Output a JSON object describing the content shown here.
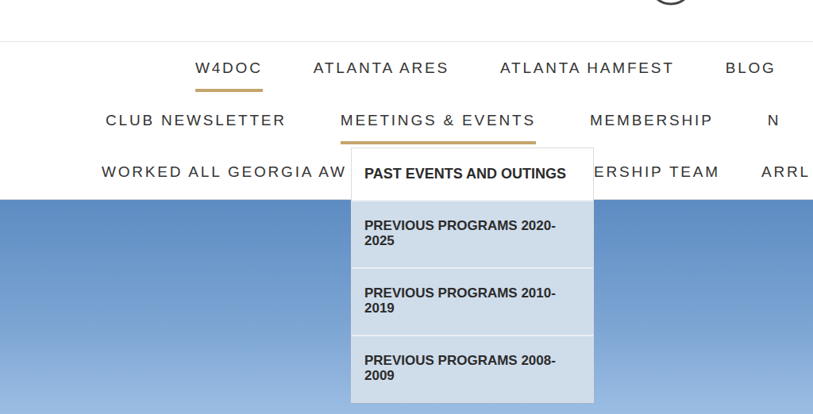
{
  "nav": {
    "rows": [
      {
        "items": [
          {
            "label": "W4DOC",
            "selected": true
          },
          {
            "label": "ATLANTA ARES",
            "selected": false
          },
          {
            "label": "ATLANTA HAMFEST",
            "selected": false
          },
          {
            "label": "BLOG",
            "selected": false
          }
        ]
      },
      {
        "items": [
          {
            "label": "CLUB NEWSLETTER",
            "selected": false
          },
          {
            "label": "MEETINGS & EVENTS",
            "selected": true
          },
          {
            "label": "MEMBERSHIP",
            "selected": false
          },
          {
            "label": "N",
            "selected": false
          }
        ]
      },
      {
        "items": [
          {
            "label": "WORKED ALL GEORGIA AW",
            "selected": false
          },
          {
            "label": "ERSHIP TEAM",
            "selected": false
          },
          {
            "label": "ARRL",
            "selected": false
          }
        ]
      }
    ]
  },
  "dropdown": {
    "items": [
      {
        "label": "PAST EVENTS AND OUTINGS",
        "selected": true
      },
      {
        "label": "PREVIOUS PROGRAMS 2020-2025",
        "selected": false
      },
      {
        "label": "PREVIOUS PROGRAMS 2010-2019",
        "selected": false
      },
      {
        "label": "PREVIOUS PROGRAMS 2008-2009",
        "selected": false
      }
    ]
  }
}
